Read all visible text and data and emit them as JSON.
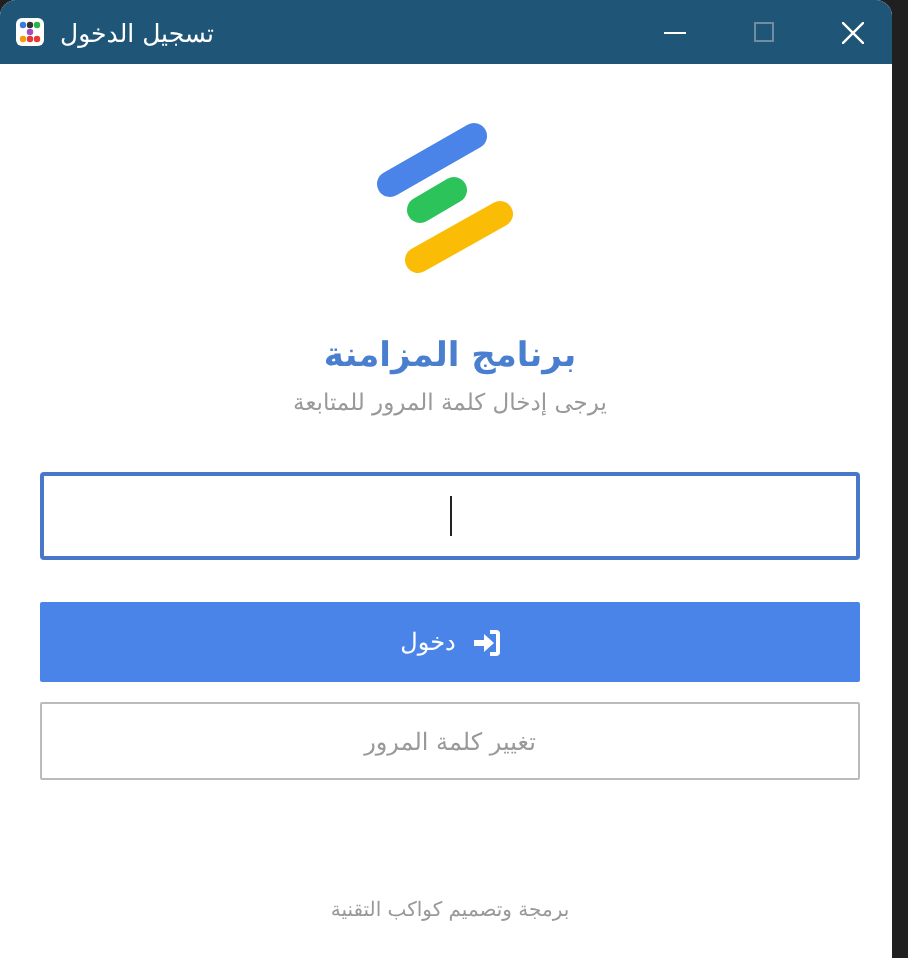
{
  "window": {
    "title": "تسجيل الدخول"
  },
  "app": {
    "name": "برنامج المزامنة",
    "subtitle": "يرجى إدخال كلمة المرور للمتابعة"
  },
  "password_field": {
    "focused": true
  },
  "buttons": [
    {
      "kind": "primary",
      "label": "دخول"
    },
    {
      "kind": "secondary",
      "label": "تغيير كلمة المرور"
    }
  ],
  "footer": "برمجة وتصميم كواكب التقنية"
}
